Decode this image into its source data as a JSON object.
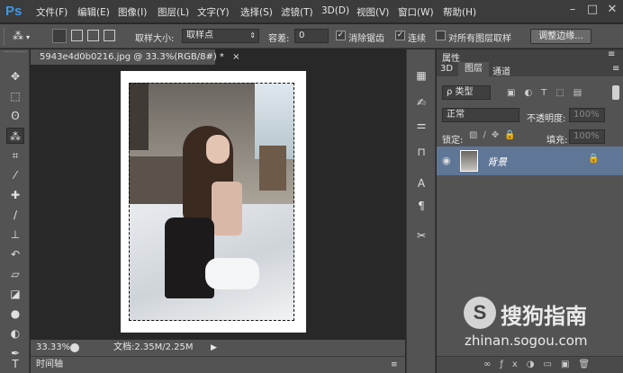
{
  "app": {
    "logo": "Ps"
  },
  "menu": [
    "文件(F)",
    "编辑(E)",
    "图像(I)",
    "图层(L)",
    "文字(Y)",
    "选择(S)",
    "滤镜(T)",
    "3D(D)",
    "视图(V)",
    "窗口(W)",
    "帮助(H)"
  ],
  "window_controls": {
    "minimize": "–",
    "maximize": "□",
    "close": "✕"
  },
  "options": {
    "sample_size_label": "取样大小:",
    "sample_size_value": "取样点",
    "tolerance_label": "容差:",
    "tolerance_value": "0",
    "antialias_label": "消除锯齿",
    "antialias_checked": true,
    "contiguous_label": "连续",
    "contiguous_checked": true,
    "all_layers_label": "对所有图层取样",
    "all_layers_checked": false,
    "refine_edge_label": "调整边缘..."
  },
  "document": {
    "tab_title": "5943e4d0b0216.jpg @ 33.3%(RGB/8#) *",
    "tab_close": "×"
  },
  "status": {
    "zoom": "33.33%",
    "doc_info": "文档:2.35M/2.25M"
  },
  "timeline": {
    "label": "时间轴"
  },
  "panel": {
    "header_tab": "属性",
    "tabs": [
      "3D",
      "图层",
      "通道"
    ],
    "active_tab_index": 1,
    "filter_type": "ρ 类型",
    "blend_mode": "正常",
    "opacity_label": "不透明度:",
    "opacity_value": "100%",
    "lock_label": "锁定:",
    "fill_label": "填充:",
    "fill_value": "100%",
    "layer_name": "背景"
  },
  "watermark": {
    "text": "搜狗指南",
    "url": "zhinan.sogou.com"
  },
  "colors": {
    "accent": "#3a97e8",
    "layer_selected": "#5f7696",
    "panel": "#535353",
    "canvas_bg": "#282828"
  }
}
